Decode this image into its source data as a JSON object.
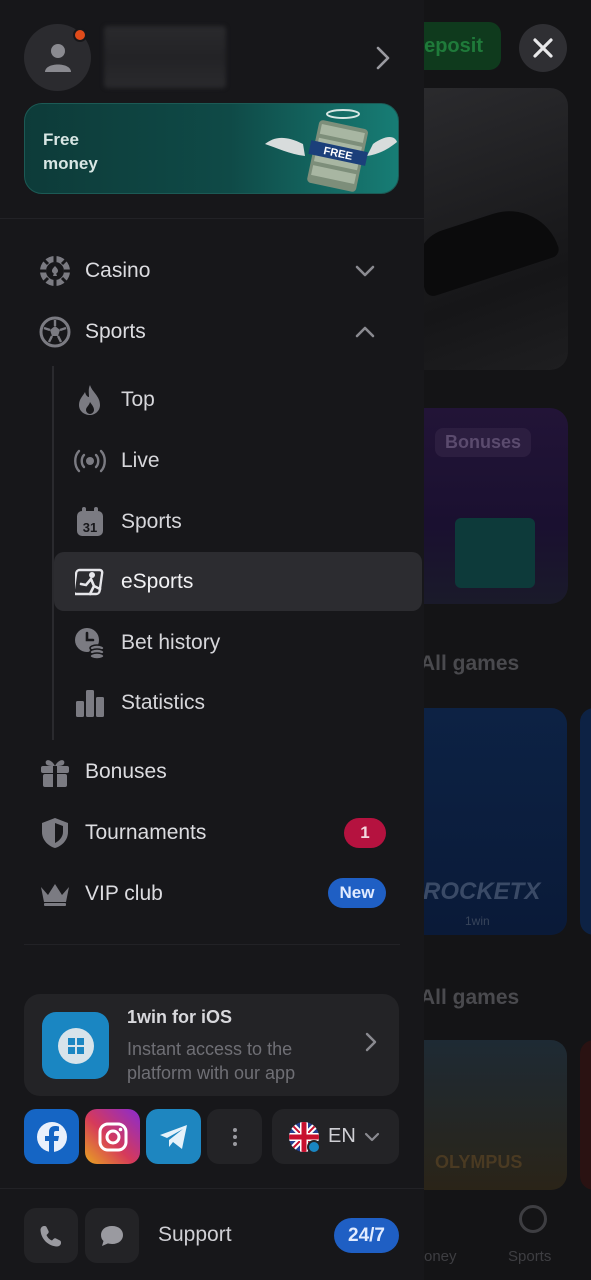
{
  "background": {
    "deposit_label": "eposit",
    "bonuses_label": "Bonuses",
    "all_games_1": "All games",
    "all_games_2": "All games",
    "game_title": "ROCKETX",
    "game_brand": "1win",
    "game2_title": "OLYMPUS",
    "tab_money": "oney",
    "tab_sports": "Sports"
  },
  "profile": {
    "avatar_icon": "user-icon",
    "has_notification": true
  },
  "promo": {
    "line1": "Free",
    "line2": "money",
    "art_label": "FREE"
  },
  "menu": {
    "casino": {
      "label": "Casino",
      "icon": "casino-chip-icon"
    },
    "sports": {
      "label": "Sports",
      "icon": "soccer-ball-icon"
    },
    "sub": {
      "top": "Top",
      "live": "Live",
      "sports": "Sports",
      "sports_icon_text": "31",
      "esports": "eSports",
      "bet_history": "Bet history",
      "statistics": "Statistics"
    },
    "bonuses": "Bonuses",
    "tournaments": "Tournaments",
    "tournaments_badge": "1",
    "vip": "VIP club",
    "vip_badge": "New"
  },
  "app_card": {
    "title": "1win for iOS",
    "description": "Instant access to the platform with our app"
  },
  "socials": [
    "facebook-icon",
    "instagram-icon",
    "telegram-icon",
    "more-icon"
  ],
  "language": {
    "code": "EN"
  },
  "support": {
    "label": "Support",
    "badge": "24/7"
  },
  "colors": {
    "accent_blue": "#1f5fc4",
    "badge_red": "#b5123f",
    "drawer_bg": "#17171a",
    "promo_teal": "#0f4a47"
  }
}
